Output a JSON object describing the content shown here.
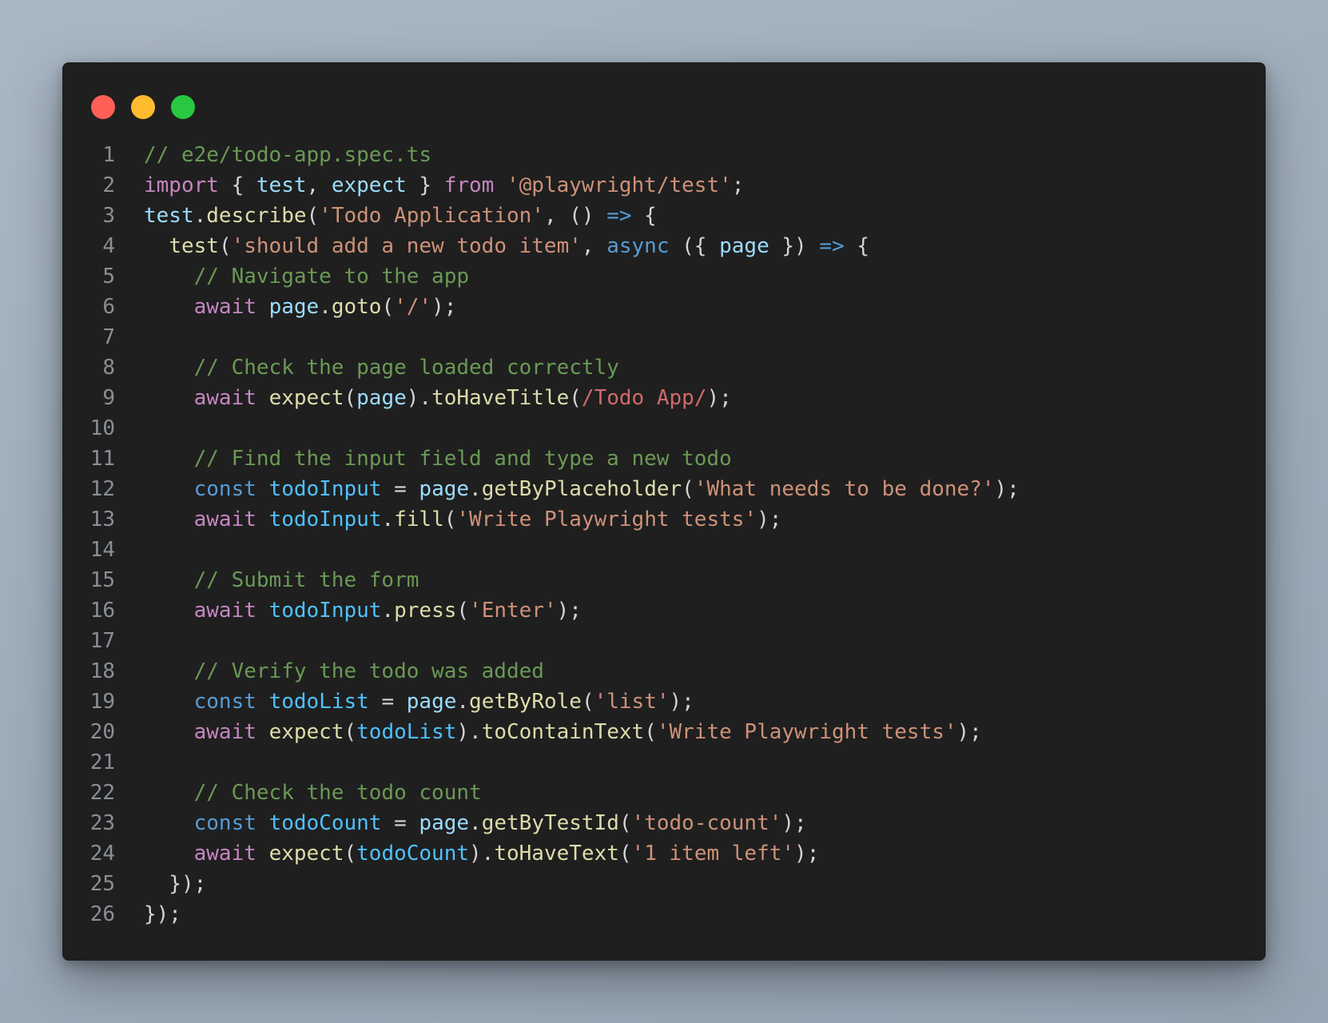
{
  "window": {
    "traffic_lights": [
      {
        "name": "close",
        "color": "#ff5f57"
      },
      {
        "name": "minimize",
        "color": "#febc2e"
      },
      {
        "name": "maximize",
        "color": "#28c840"
      }
    ]
  },
  "colors": {
    "comment": "#6a9955",
    "keyword": "#c586c0",
    "storage": "#569cd6",
    "variable": "#9cdcfe",
    "constant": "#4fc1ff",
    "function": "#dcdcaa",
    "string": "#ce9178",
    "regex": "#d16969",
    "punct": "#d4d4d4"
  },
  "code": {
    "lines": [
      {
        "n": "1",
        "tokens": [
          [
            "comment",
            "// e2e/todo-app.spec.ts"
          ]
        ]
      },
      {
        "n": "2",
        "tokens": [
          [
            "keyword",
            "import"
          ],
          [
            "punct",
            " { "
          ],
          [
            "variable",
            "test"
          ],
          [
            "punct",
            ", "
          ],
          [
            "variable",
            "expect"
          ],
          [
            "punct",
            " } "
          ],
          [
            "keyword",
            "from"
          ],
          [
            "punct",
            " "
          ],
          [
            "string",
            "'@playwright/test'"
          ],
          [
            "punct",
            ";"
          ]
        ]
      },
      {
        "n": "3",
        "tokens": [
          [
            "variable",
            "test"
          ],
          [
            "punct",
            "."
          ],
          [
            "function",
            "describe"
          ],
          [
            "punct",
            "("
          ],
          [
            "string",
            "'Todo Application'"
          ],
          [
            "punct",
            ", () "
          ],
          [
            "arrow",
            "=>"
          ],
          [
            "punct",
            " {"
          ]
        ]
      },
      {
        "n": "4",
        "tokens": [
          [
            "punct",
            "  "
          ],
          [
            "function",
            "test"
          ],
          [
            "punct",
            "("
          ],
          [
            "string",
            "'should add a new todo item'"
          ],
          [
            "punct",
            ", "
          ],
          [
            "storage",
            "async"
          ],
          [
            "punct",
            " ({ "
          ],
          [
            "variable",
            "page"
          ],
          [
            "punct",
            " }) "
          ],
          [
            "arrow",
            "=>"
          ],
          [
            "punct",
            " {"
          ]
        ]
      },
      {
        "n": "5",
        "tokens": [
          [
            "punct",
            "    "
          ],
          [
            "comment",
            "// Navigate to the app"
          ]
        ]
      },
      {
        "n": "6",
        "tokens": [
          [
            "punct",
            "    "
          ],
          [
            "keyword",
            "await"
          ],
          [
            "punct",
            " "
          ],
          [
            "variable",
            "page"
          ],
          [
            "punct",
            "."
          ],
          [
            "function",
            "goto"
          ],
          [
            "punct",
            "("
          ],
          [
            "string",
            "'/'"
          ],
          [
            "punct",
            ");"
          ]
        ]
      },
      {
        "n": "7",
        "tokens": []
      },
      {
        "n": "8",
        "tokens": [
          [
            "punct",
            "    "
          ],
          [
            "comment",
            "// Check the page loaded correctly"
          ]
        ]
      },
      {
        "n": "9",
        "tokens": [
          [
            "punct",
            "    "
          ],
          [
            "keyword",
            "await"
          ],
          [
            "punct",
            " "
          ],
          [
            "function",
            "expect"
          ],
          [
            "punct",
            "("
          ],
          [
            "variable",
            "page"
          ],
          [
            "punct",
            ")."
          ],
          [
            "function",
            "toHaveTitle"
          ],
          [
            "punct",
            "("
          ],
          [
            "regex",
            "/Todo App/"
          ],
          [
            "punct",
            ");"
          ]
        ]
      },
      {
        "n": "10",
        "tokens": []
      },
      {
        "n": "11",
        "tokens": [
          [
            "punct",
            "    "
          ],
          [
            "comment",
            "// Find the input field and type a new todo"
          ]
        ]
      },
      {
        "n": "12",
        "tokens": [
          [
            "punct",
            "    "
          ],
          [
            "storage",
            "const"
          ],
          [
            "punct",
            " "
          ],
          [
            "constant",
            "todoInput"
          ],
          [
            "punct",
            " = "
          ],
          [
            "variable",
            "page"
          ],
          [
            "punct",
            "."
          ],
          [
            "function",
            "getByPlaceholder"
          ],
          [
            "punct",
            "("
          ],
          [
            "string",
            "'What needs to be done?'"
          ],
          [
            "punct",
            ");"
          ]
        ]
      },
      {
        "n": "13",
        "tokens": [
          [
            "punct",
            "    "
          ],
          [
            "keyword",
            "await"
          ],
          [
            "punct",
            " "
          ],
          [
            "constant",
            "todoInput"
          ],
          [
            "punct",
            "."
          ],
          [
            "function",
            "fill"
          ],
          [
            "punct",
            "("
          ],
          [
            "string",
            "'Write Playwright tests'"
          ],
          [
            "punct",
            ");"
          ]
        ]
      },
      {
        "n": "14",
        "tokens": []
      },
      {
        "n": "15",
        "tokens": [
          [
            "punct",
            "    "
          ],
          [
            "comment",
            "// Submit the form"
          ]
        ]
      },
      {
        "n": "16",
        "tokens": [
          [
            "punct",
            "    "
          ],
          [
            "keyword",
            "await"
          ],
          [
            "punct",
            " "
          ],
          [
            "constant",
            "todoInput"
          ],
          [
            "punct",
            "."
          ],
          [
            "function",
            "press"
          ],
          [
            "punct",
            "("
          ],
          [
            "string",
            "'Enter'"
          ],
          [
            "punct",
            ");"
          ]
        ]
      },
      {
        "n": "17",
        "tokens": []
      },
      {
        "n": "18",
        "tokens": [
          [
            "punct",
            "    "
          ],
          [
            "comment",
            "// Verify the todo was added"
          ]
        ]
      },
      {
        "n": "19",
        "tokens": [
          [
            "punct",
            "    "
          ],
          [
            "storage",
            "const"
          ],
          [
            "punct",
            " "
          ],
          [
            "constant",
            "todoList"
          ],
          [
            "punct",
            " = "
          ],
          [
            "variable",
            "page"
          ],
          [
            "punct",
            "."
          ],
          [
            "function",
            "getByRole"
          ],
          [
            "punct",
            "("
          ],
          [
            "string",
            "'list'"
          ],
          [
            "punct",
            ");"
          ]
        ]
      },
      {
        "n": "20",
        "tokens": [
          [
            "punct",
            "    "
          ],
          [
            "keyword",
            "await"
          ],
          [
            "punct",
            " "
          ],
          [
            "function",
            "expect"
          ],
          [
            "punct",
            "("
          ],
          [
            "constant",
            "todoList"
          ],
          [
            "punct",
            ")."
          ],
          [
            "function",
            "toContainText"
          ],
          [
            "punct",
            "("
          ],
          [
            "string",
            "'Write Playwright tests'"
          ],
          [
            "punct",
            ");"
          ]
        ]
      },
      {
        "n": "21",
        "tokens": []
      },
      {
        "n": "22",
        "tokens": [
          [
            "punct",
            "    "
          ],
          [
            "comment",
            "// Check the todo count"
          ]
        ]
      },
      {
        "n": "23",
        "tokens": [
          [
            "punct",
            "    "
          ],
          [
            "storage",
            "const"
          ],
          [
            "punct",
            " "
          ],
          [
            "constant",
            "todoCount"
          ],
          [
            "punct",
            " = "
          ],
          [
            "variable",
            "page"
          ],
          [
            "punct",
            "."
          ],
          [
            "function",
            "getByTestId"
          ],
          [
            "punct",
            "("
          ],
          [
            "string",
            "'todo-count'"
          ],
          [
            "punct",
            ");"
          ]
        ]
      },
      {
        "n": "24",
        "tokens": [
          [
            "punct",
            "    "
          ],
          [
            "keyword",
            "await"
          ],
          [
            "punct",
            " "
          ],
          [
            "function",
            "expect"
          ],
          [
            "punct",
            "("
          ],
          [
            "constant",
            "todoCount"
          ],
          [
            "punct",
            ")."
          ],
          [
            "function",
            "toHaveText"
          ],
          [
            "punct",
            "("
          ],
          [
            "string",
            "'1 item left'"
          ],
          [
            "punct",
            ");"
          ]
        ]
      },
      {
        "n": "25",
        "tokens": [
          [
            "punct",
            "  });"
          ]
        ]
      },
      {
        "n": "26",
        "tokens": [
          [
            "punct",
            "});"
          ]
        ]
      }
    ]
  }
}
